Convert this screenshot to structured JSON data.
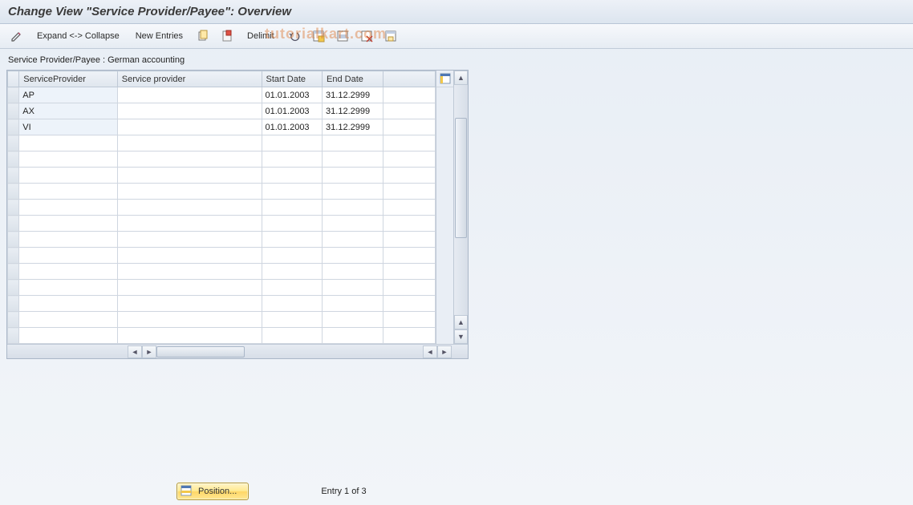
{
  "title": "Change View \"Service Provider/Payee\": Overview",
  "toolbar": {
    "expand_collapse": "Expand <-> Collapse",
    "new_entries": "New Entries",
    "delimit": "Delimit"
  },
  "watermark": "tutorialkart.com",
  "subtitle": "Service Provider/Payee : German accounting",
  "grid": {
    "columns": {
      "service_provider_key": "ServiceProvider",
      "service_provider_desc": "Service provider",
      "start_date": "Start Date",
      "end_date": "End Date"
    },
    "rows": [
      {
        "sp": "AP",
        "desc": "",
        "start": "01.01.2003",
        "end": "31.12.2999"
      },
      {
        "sp": "AX",
        "desc": "",
        "start": "01.01.2003",
        "end": "31.12.2999"
      },
      {
        "sp": "VI",
        "desc": "",
        "start": "01.01.2003",
        "end": "31.12.2999"
      }
    ],
    "empty_rows": 13
  },
  "footer": {
    "position_label": "Position...",
    "entry_text": "Entry 1 of 3"
  }
}
